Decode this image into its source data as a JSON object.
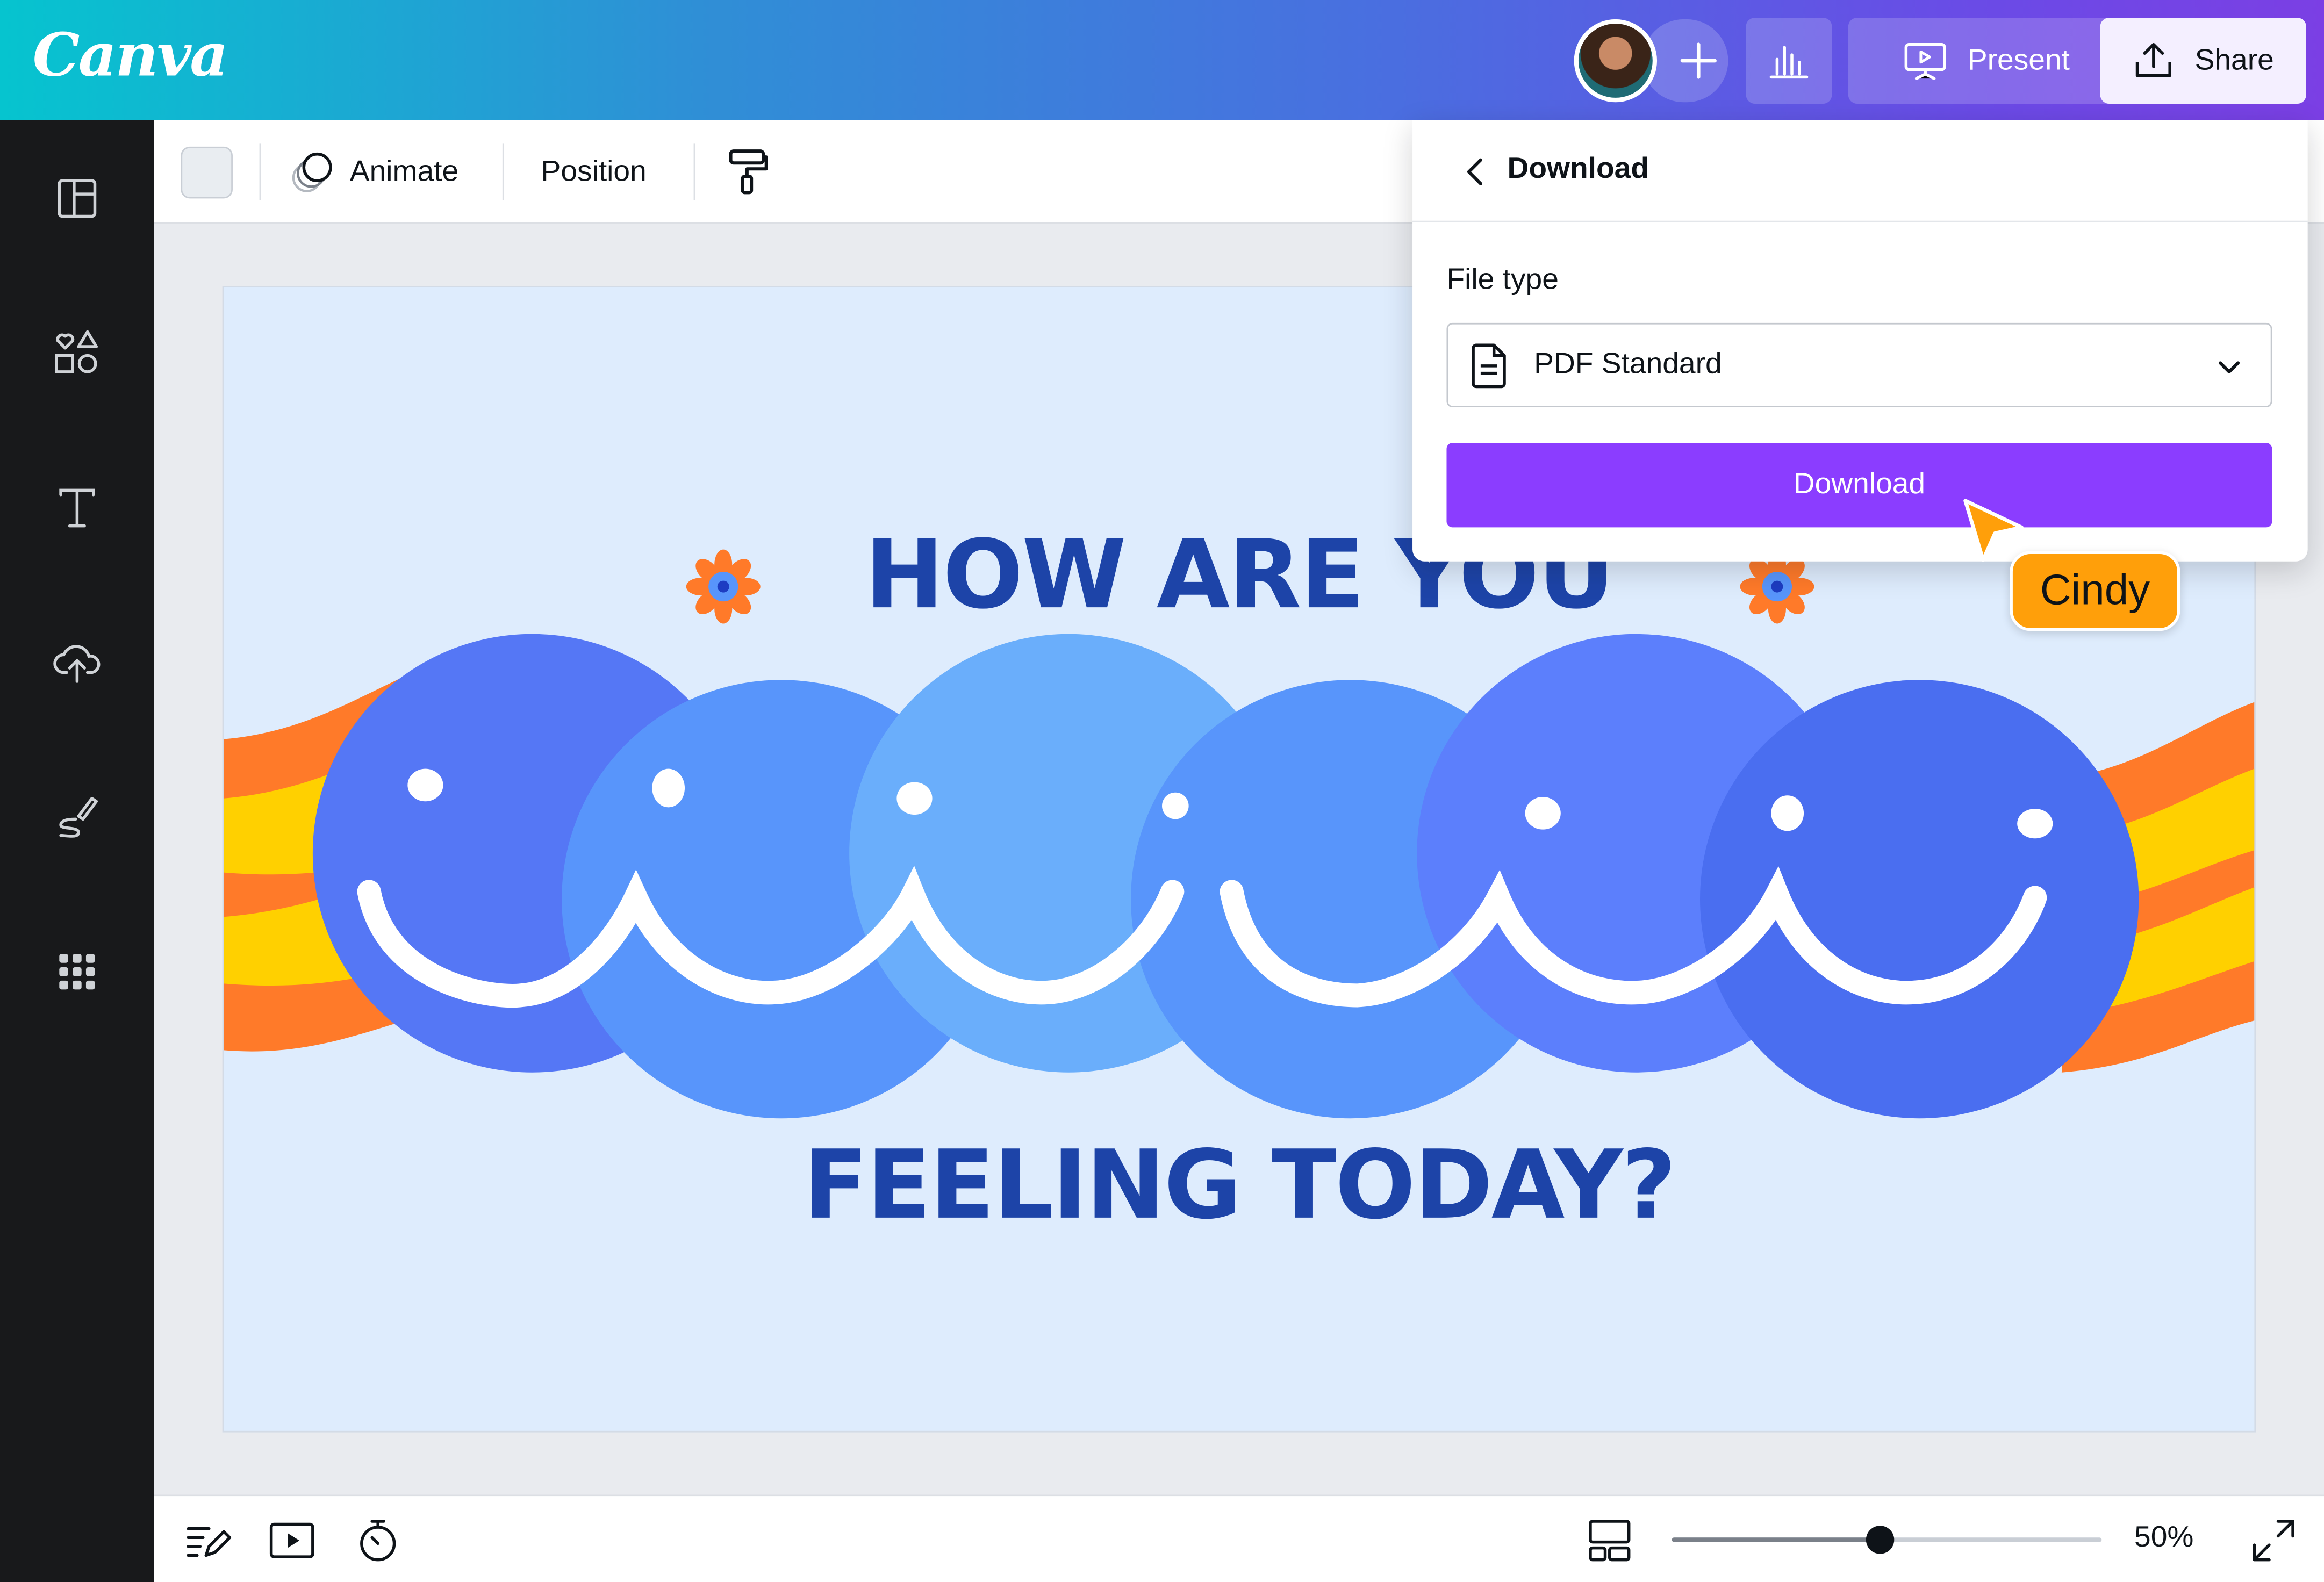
{
  "app": {
    "logo_text": "Canva"
  },
  "header": {
    "present_label": "Present",
    "share_label": "Share"
  },
  "toolbar": {
    "animate_label": "Animate",
    "position_label": "Position"
  },
  "design": {
    "headline_top": "HOW ARE YOU",
    "headline_bottom": "FEELING TODAY?",
    "colors": {
      "background": "#deecfd",
      "headline": "#1d44a8",
      "stripe_orange": "#ff7a29",
      "stripe_yellow": "#ffd000"
    }
  },
  "download_panel": {
    "title": "Download",
    "file_type_label": "File type",
    "file_type_value": "PDF Standard",
    "download_button_label": "Download"
  },
  "collaborator": {
    "name": "Cindy",
    "color": "#ff9f0a"
  },
  "bottom_bar": {
    "zoom_label": "50%",
    "zoom_level": 0.5
  },
  "colors": {
    "accent": "#8b3dff"
  }
}
